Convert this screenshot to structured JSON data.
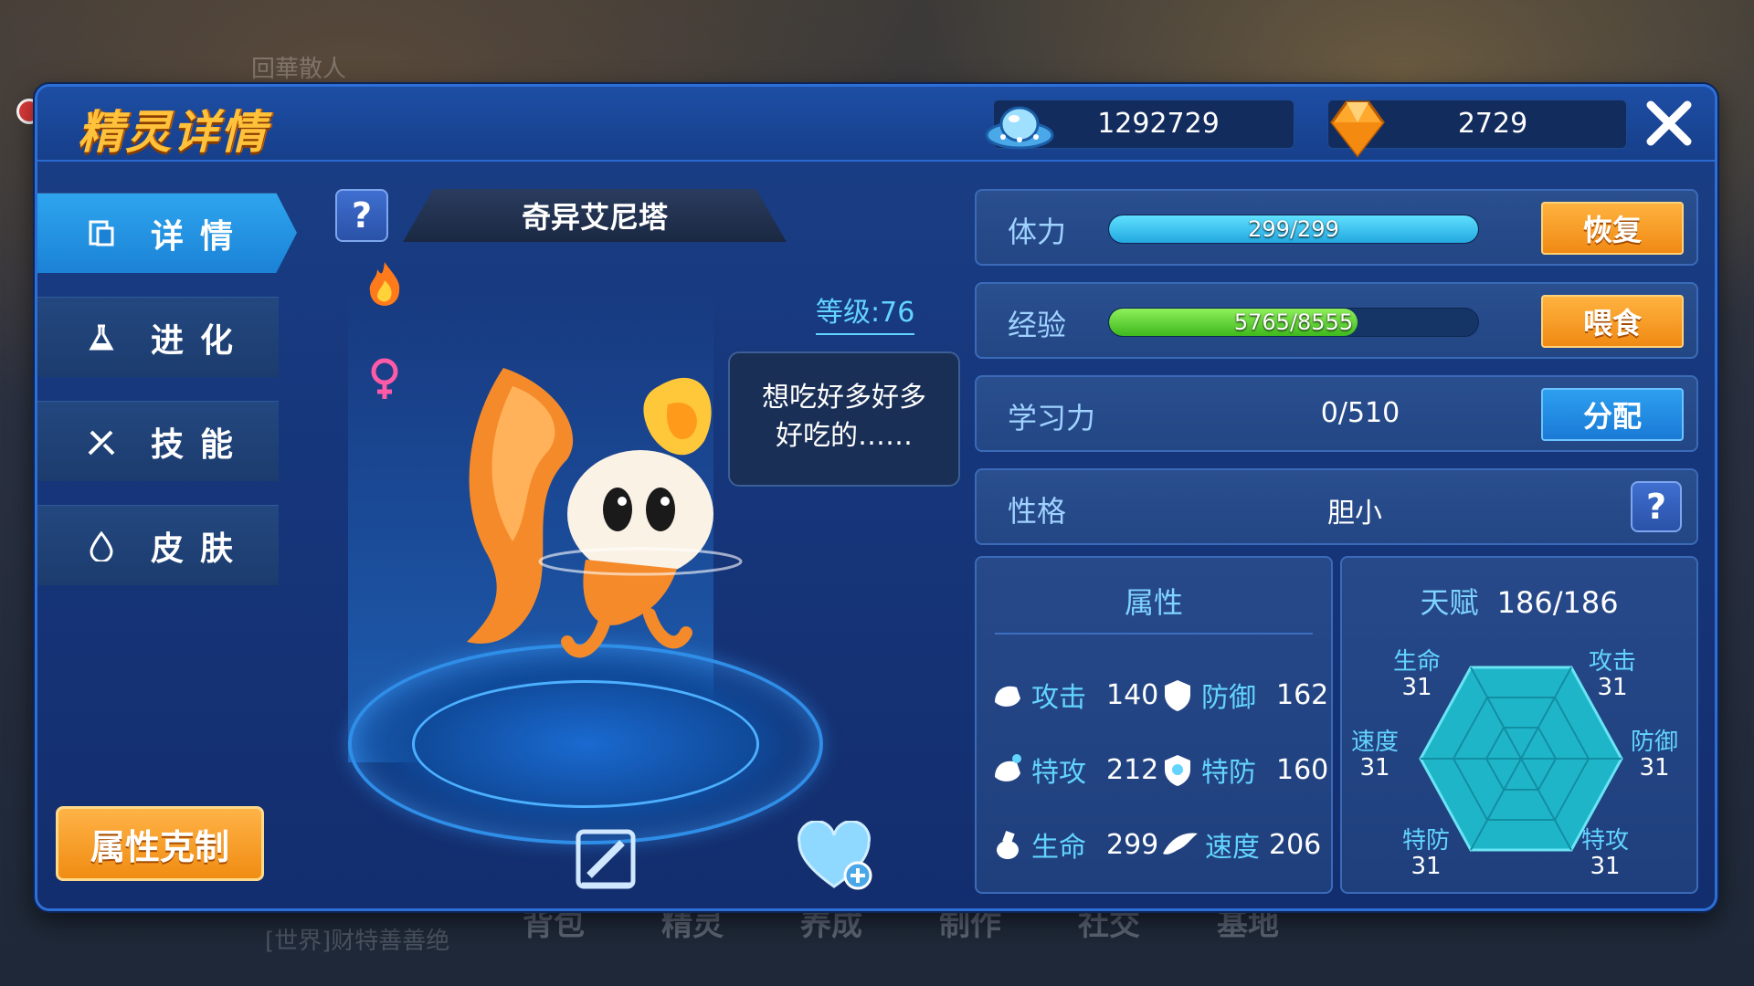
{
  "background": {
    "top_text": "回華散人",
    "bottom_text": "[世界]财特善善绝",
    "nav": [
      "背包",
      "精灵",
      "养成",
      "制作",
      "社交",
      "基地"
    ]
  },
  "header": {
    "title": "精灵详情",
    "currency_coins": "1292729",
    "currency_diamonds": "2729"
  },
  "sidebar": {
    "items": [
      {
        "label": "详情",
        "icon": "document-icon",
        "active": true
      },
      {
        "label": "进化",
        "icon": "flask-icon",
        "active": false
      },
      {
        "label": "技能",
        "icon": "swords-icon",
        "active": false
      },
      {
        "label": "皮肤",
        "icon": "droplet-icon",
        "active": false
      }
    ],
    "type_chart_button": "属性克制"
  },
  "pet": {
    "name": "奇异艾尼塔",
    "level": "等级:76",
    "speech_line1": "想吃好多好多",
    "speech_line2": "好吃的……",
    "element_icon": "fire-icon",
    "gender_icon": "female-icon"
  },
  "stats": {
    "hp": {
      "label": "体力",
      "text": "299/299",
      "fraction": 1.0,
      "button": "恢复"
    },
    "exp": {
      "label": "经验",
      "text": "5765/8555",
      "fraction": 0.674,
      "button": "喂食"
    },
    "learning": {
      "label": "学习力",
      "value": "0/510",
      "button": "分配"
    },
    "nature": {
      "label": "性格",
      "value": "胆小"
    }
  },
  "attributes": {
    "title": "属性",
    "items": [
      {
        "label": "攻击",
        "value": "140"
      },
      {
        "label": "防御",
        "value": "162"
      },
      {
        "label": "特攻",
        "value": "212"
      },
      {
        "label": "特防",
        "value": "160"
      },
      {
        "label": "生命",
        "value": "299"
      },
      {
        "label": "速度",
        "value": "206"
      }
    ]
  },
  "talent": {
    "title": "天赋",
    "total": "186/186",
    "items": [
      {
        "label": "生命",
        "value": "31"
      },
      {
        "label": "攻击",
        "value": "31"
      },
      {
        "label": "防御",
        "value": "31"
      },
      {
        "label": "特攻",
        "value": "31"
      },
      {
        "label": "特防",
        "value": "31"
      },
      {
        "label": "速度",
        "value": "31"
      }
    ]
  },
  "colors": {
    "accent_orange": "#f08a14",
    "accent_blue": "#1a7ad6",
    "hp_bar": "#36c7f2",
    "exp_bar": "#5fd43a",
    "label_cyan": "#63d4ff"
  }
}
